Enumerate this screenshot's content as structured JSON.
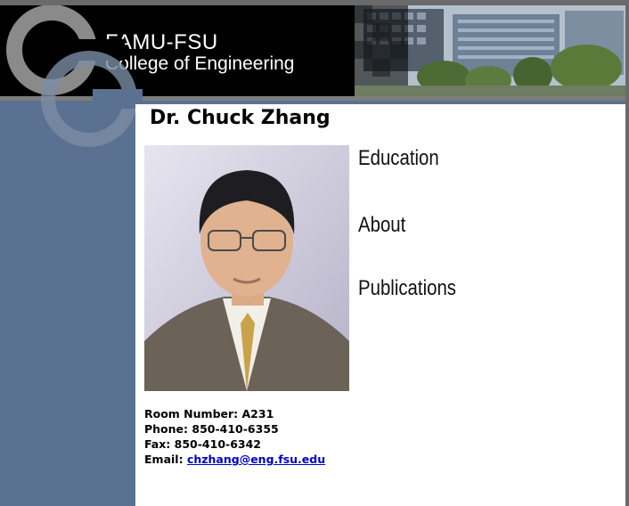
{
  "header": {
    "line1": "FAMU-FSU",
    "line2": "College of Engineering"
  },
  "profile": {
    "name": "Dr. Chuck Zhang"
  },
  "nav": {
    "education": "Education",
    "about": "About",
    "publications": "Publications"
  },
  "contact": {
    "room": "Room Number: A231",
    "phone": "Phone: 850-410-6355",
    "fax": "Fax: 850-410-6342",
    "email_label": "Email:",
    "email": "chzhang@eng.fsu.edu"
  },
  "colors": {
    "sidebar": "#5a7191",
    "header_bg": "#000000",
    "link": "#0000cc"
  }
}
